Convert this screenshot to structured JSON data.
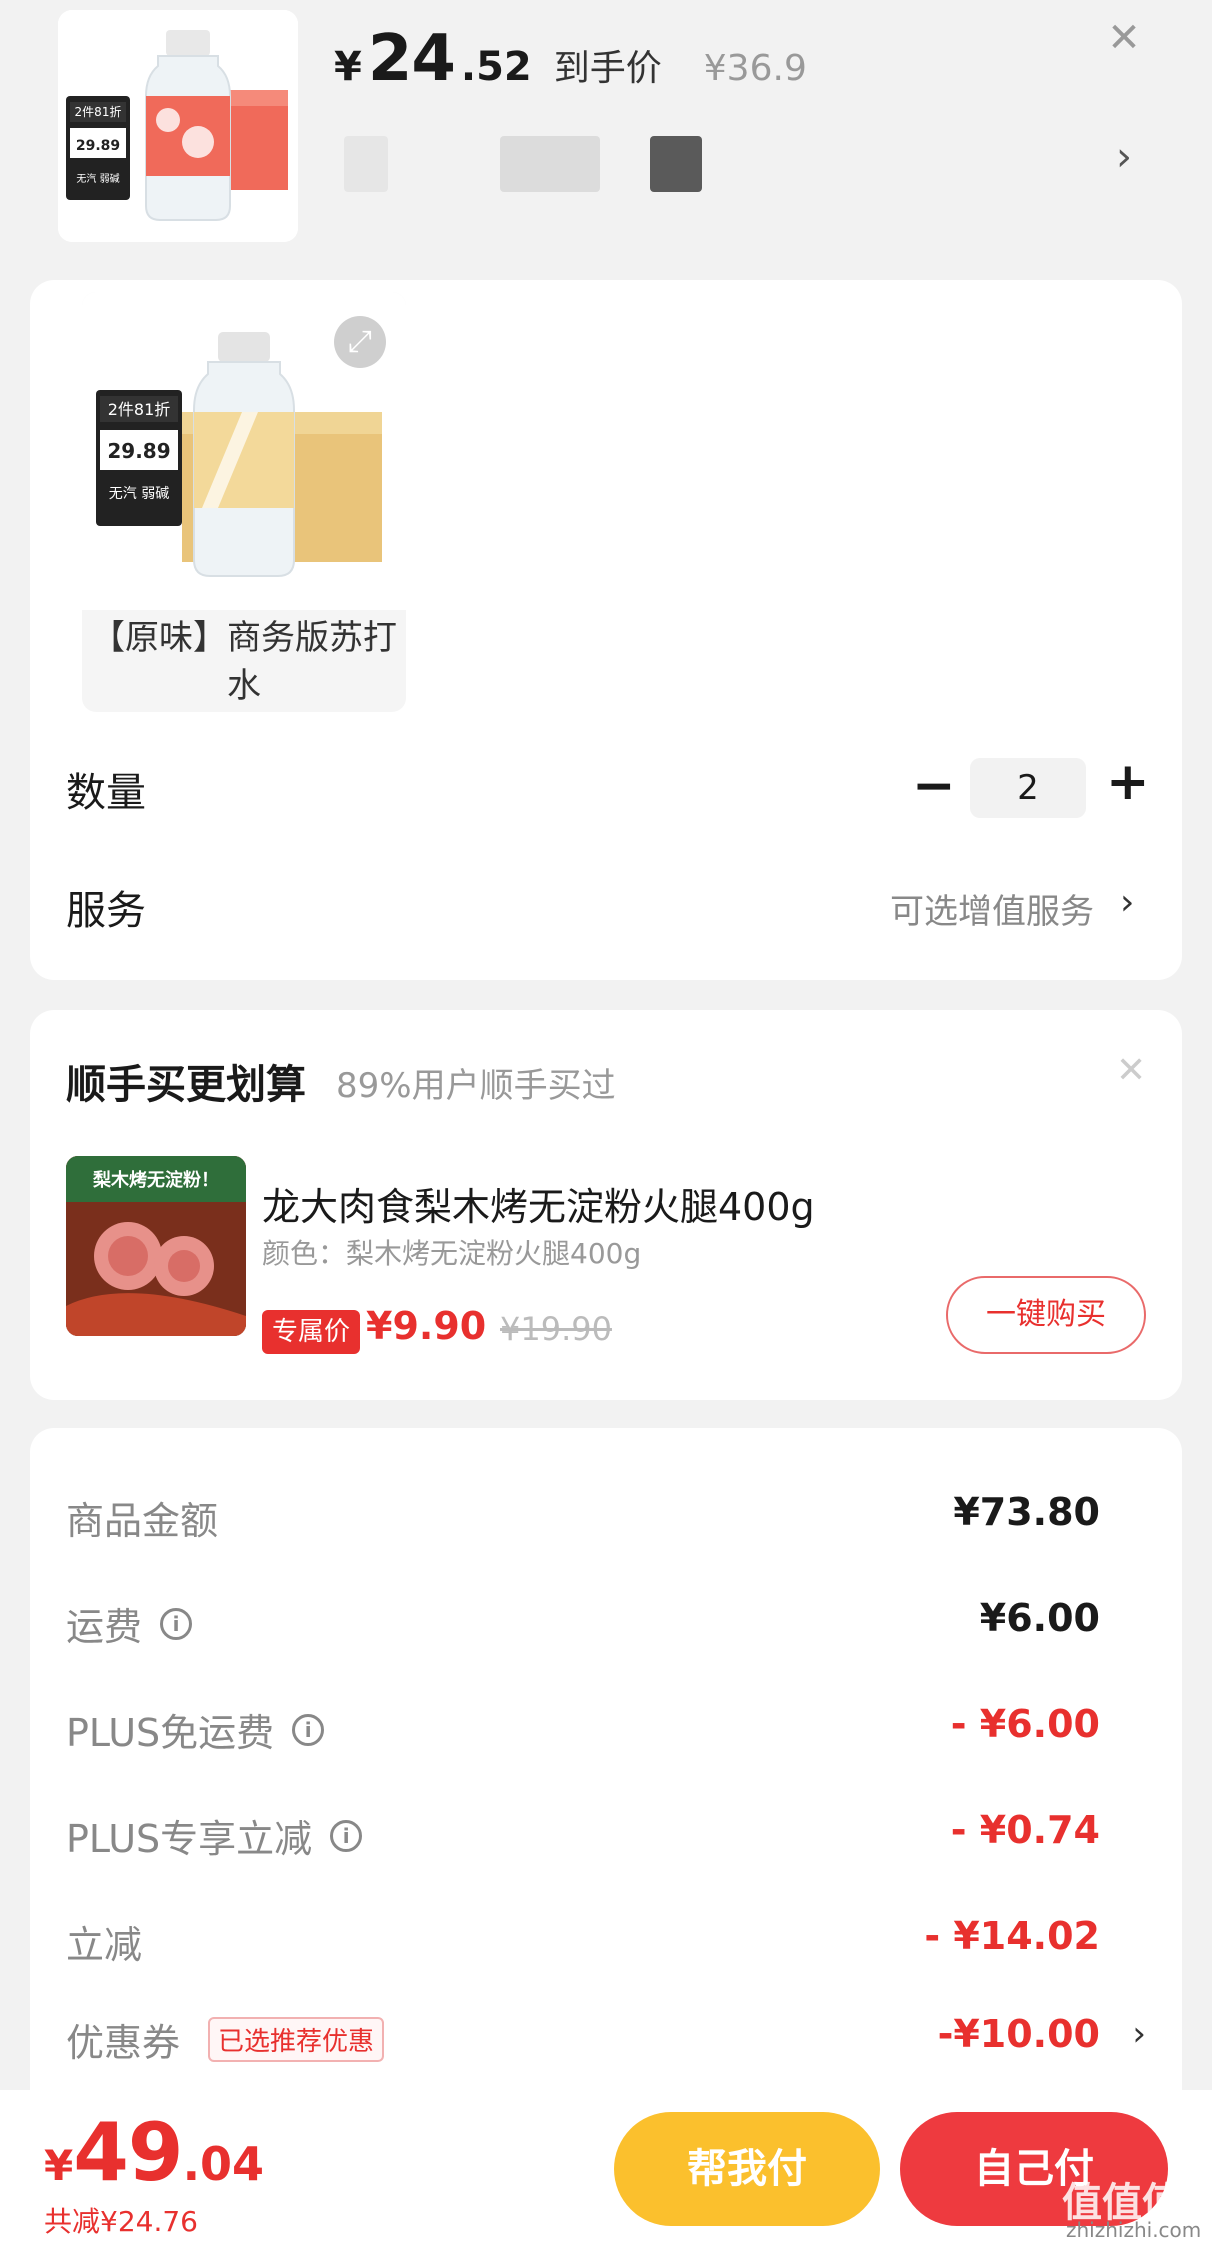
{
  "header": {
    "price_currency": "¥",
    "price_int": "24",
    "price_dec": ".52",
    "price_tag": "到手价",
    "original_price": "¥36.9",
    "close_icon": "✕",
    "chevron": "›",
    "thumb_badge": "2件81折",
    "thumb_price": "29.89",
    "thumb_note": "无汽 弱碱"
  },
  "variant": {
    "label": "【原味】商务版苏打水",
    "img_badge": "2件81折",
    "img_price": "29.89",
    "img_note": "无汽 弱碱",
    "expand_icon": "⤢"
  },
  "quantity": {
    "label": "数量",
    "minus": "−",
    "value": "2",
    "plus": "+"
  },
  "service": {
    "label": "服务",
    "value": "可选增值服务",
    "chevron": "›"
  },
  "upsell": {
    "title": "顺手买更划算",
    "subtitle": "89%用户顺手买过",
    "close": "✕",
    "product_name": "龙大肉食梨木烤无淀粉火腿400g",
    "product_spec": "颜色：梨木烤无淀粉火腿400g",
    "badge": "专属价",
    "price": "¥9.90",
    "original_price": "¥19.90",
    "button": "一键购买",
    "img_text": "梨木烤无淀粉！"
  },
  "summary": [
    {
      "label": "商品金额",
      "value": "¥73.80",
      "info": false,
      "red": false
    },
    {
      "label": "运费",
      "value": "¥6.00",
      "info": true,
      "red": false
    },
    {
      "label": "PLUS免运费",
      "value": "- ¥6.00",
      "info": true,
      "red": true
    },
    {
      "label": "PLUS专享立减",
      "value": "- ¥0.74",
      "info": true,
      "red": true
    },
    {
      "label": "立减",
      "value": "- ¥14.02",
      "info": false,
      "red": true
    },
    {
      "label": "优惠券",
      "value": "-¥10.00",
      "info": false,
      "red": true,
      "tag": "已选推荐优惠",
      "chevron": "›"
    }
  ],
  "footer": {
    "total_currency": "¥",
    "total_int": "49",
    "total_dec": ".04",
    "saved": "共减¥24.76",
    "help_pay": "帮我付",
    "self_pay": "自己付"
  },
  "watermark": {
    "text": "值值值",
    "sub": "zhizhizhi.com"
  },
  "colors": {
    "accent_red": "#e8302e",
    "help_yellow": "#fbc02d",
    "self_red": "#ee3a3f"
  }
}
